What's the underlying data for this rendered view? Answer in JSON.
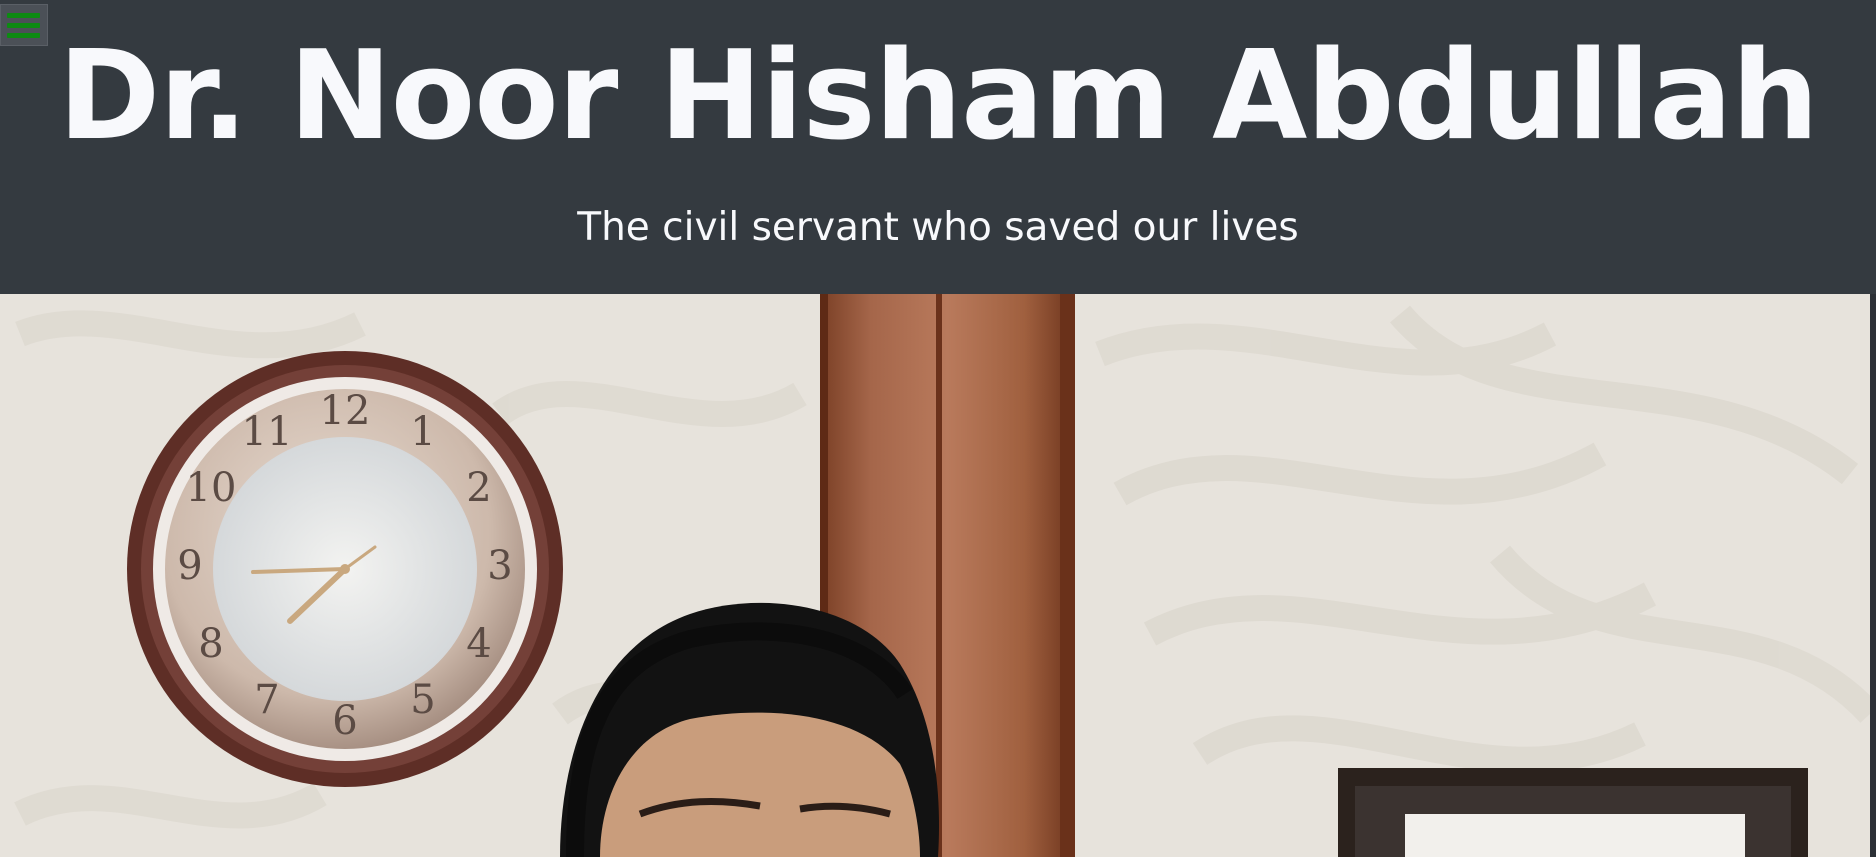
{
  "header": {
    "title": "Dr. Noor Hisham Abdullah",
    "subtitle": "The civil servant who saved our lives"
  },
  "menu": {
    "icon": "hamburger-menu-icon",
    "color": "#0d8a12"
  },
  "colors": {
    "header_bg": "#343a40",
    "title_text": "#f8f9fc"
  },
  "photo": {
    "clock_numerals": [
      "12",
      "1",
      "2",
      "3",
      "4",
      "5",
      "6",
      "7",
      "8",
      "9",
      "10",
      "11"
    ]
  }
}
